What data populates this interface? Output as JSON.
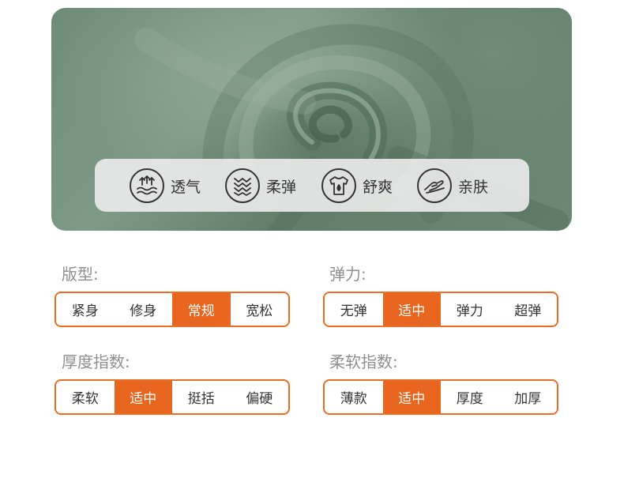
{
  "colors": {
    "accent": "#e8661f",
    "fabric": "#6e8c78",
    "label": "#8f8f8f",
    "text": "#333333"
  },
  "features": [
    {
      "icon": "breathable-icon",
      "label": "透气"
    },
    {
      "icon": "stretch-icon",
      "label": "柔弹"
    },
    {
      "icon": "tshirt-drop-icon",
      "label": "舒爽"
    },
    {
      "icon": "hand-skin-icon",
      "label": "亲肤"
    }
  ],
  "groups": [
    {
      "label": "版型:",
      "options": [
        "紧身",
        "修身",
        "常规",
        "宽松"
      ],
      "selected": "常规"
    },
    {
      "label": "弹力:",
      "options": [
        "无弹",
        "适中",
        "弹力",
        "超弹"
      ],
      "selected": "适中"
    },
    {
      "label": "厚度指数:",
      "options": [
        "柔软",
        "适中",
        "挺括",
        "偏硬"
      ],
      "selected": "适中"
    },
    {
      "label": "柔软指数:",
      "options": [
        "薄款",
        "适中",
        "厚度",
        "加厚"
      ],
      "selected": "适中"
    }
  ]
}
